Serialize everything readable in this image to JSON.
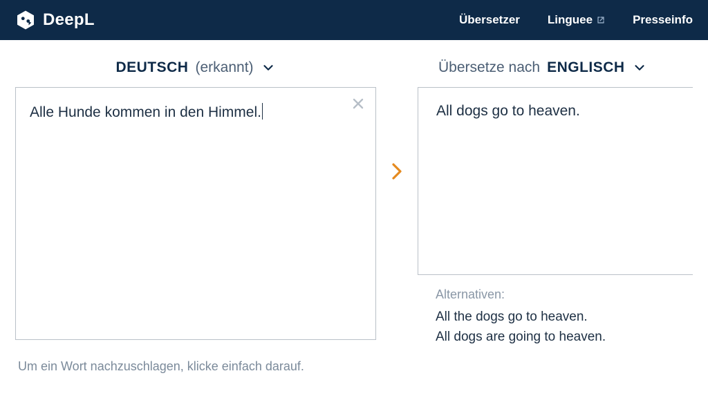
{
  "header": {
    "brand": "DeepL",
    "nav": {
      "translator": "Übersetzer",
      "linguee": "Linguee",
      "press": "Presseinfo"
    }
  },
  "source": {
    "lang_label_strong": "DEUTSCH",
    "lang_label_light": "(erkannt)",
    "text": "Alle Hunde kommen in den Himmel."
  },
  "target": {
    "prefix": "Übersetze nach",
    "lang_label_strong": "ENGLISCH",
    "text": "All dogs go to heaven."
  },
  "alternatives": {
    "label": "Alternativen:",
    "items": [
      "All the dogs go to heaven.",
      "All dogs are going to heaven."
    ]
  },
  "hint": "Um ein Wort nachzuschlagen, klicke einfach darauf."
}
